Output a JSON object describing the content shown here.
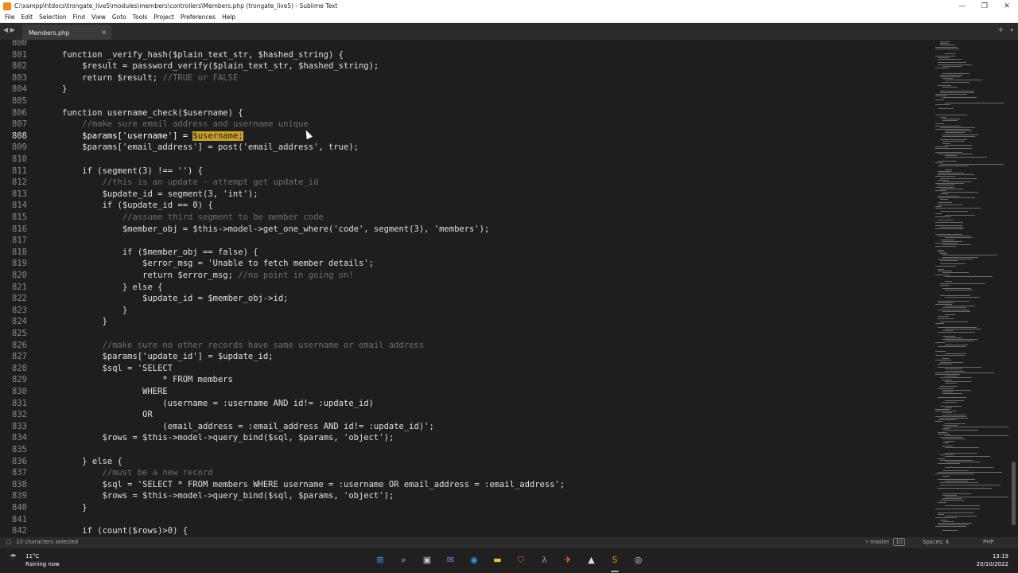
{
  "window": {
    "title": "C:\\xampp\\htdocs\\trongate_live5\\modules\\members\\controllers\\Members.php (trongate_live5) - Sublime Text",
    "min_glyph": "—",
    "max_glyph": "❐",
    "close_glyph": "✕"
  },
  "menu": [
    "File",
    "Edit",
    "Selection",
    "Find",
    "View",
    "Goto",
    "Tools",
    "Project",
    "Preferences",
    "Help"
  ],
  "tabs": {
    "nav_glyph": "◀ ▶",
    "active_tab": "Members.php",
    "close_glyph": "×",
    "add_glyph": "+",
    "menu_glyph": "▾"
  },
  "editor": {
    "line_numbers": [
      "800",
      "801",
      "802",
      "803",
      "804",
      "805",
      "806",
      "807",
      "808",
      "809",
      "810",
      "811",
      "812",
      "813",
      "814",
      "815",
      "816",
      "817",
      "818",
      "819",
      "820",
      "821",
      "822",
      "823",
      "824",
      "825",
      "826",
      "827",
      "828",
      "829",
      "830",
      "831",
      "832",
      "833",
      "834",
      "835",
      "836",
      "837",
      "838",
      "839",
      "840",
      "841",
      "842"
    ],
    "current_line": "808",
    "lines": [
      [
        {
          "t": ""
        }
      ],
      [
        {
          "t": "function _verify_hash($plain_text_str, $hashed_string) {"
        }
      ],
      [
        {
          "t": "    $result = password_verify($plain_text_str, $hashed_string);"
        }
      ],
      [
        {
          "t": "    return $result; "
        },
        {
          "t": "//TRUE or FALSE",
          "c": "comment"
        }
      ],
      [
        {
          "t": "}"
        }
      ],
      [
        {
          "t": ""
        }
      ],
      [
        {
          "t": "function username_check($username) {"
        }
      ],
      [
        {
          "t": "    "
        },
        {
          "t": "//make sure email address and username unique",
          "c": "comment"
        }
      ],
      [
        {
          "t": "    $params['username'] = "
        },
        {
          "t": "$username;",
          "c": "hl"
        }
      ],
      [
        {
          "t": "    $params['email_address'] = post('email_address', true);"
        }
      ],
      [
        {
          "t": ""
        }
      ],
      [
        {
          "t": "    if (segment(3) !== '') {"
        }
      ],
      [
        {
          "t": "        "
        },
        {
          "t": "//this is an update - attempt get update_id",
          "c": "comment"
        }
      ],
      [
        {
          "t": "        $update_id = segment(3, 'int');"
        }
      ],
      [
        {
          "t": "        if ($update_id == 0) {"
        }
      ],
      [
        {
          "t": "            "
        },
        {
          "t": "//assume third segment to be member code",
          "c": "comment"
        }
      ],
      [
        {
          "t": "            $member_obj = $this->model->get_one_where('code', segment(3), 'members');"
        }
      ],
      [
        {
          "t": ""
        }
      ],
      [
        {
          "t": "            if ($member_obj == false) {"
        }
      ],
      [
        {
          "t": "                $error_msg = 'Unable to fetch member details';"
        }
      ],
      [
        {
          "t": "                return $error_msg; "
        },
        {
          "t": "//no point in going on!",
          "c": "comment"
        }
      ],
      [
        {
          "t": "            } else {"
        }
      ],
      [
        {
          "t": "                $update_id = $member_obj->id;"
        }
      ],
      [
        {
          "t": "            }"
        }
      ],
      [
        {
          "t": "        }"
        }
      ],
      [
        {
          "t": ""
        }
      ],
      [
        {
          "t": "        "
        },
        {
          "t": "//make sure no other records have same username or email address",
          "c": "comment"
        }
      ],
      [
        {
          "t": "        $params['update_id'] = $update_id;"
        }
      ],
      [
        {
          "t": "        $sql = 'SELECT"
        }
      ],
      [
        {
          "t": "                    * FROM members"
        }
      ],
      [
        {
          "t": "                WHERE"
        }
      ],
      [
        {
          "t": "                    (username = :username AND id!= :update_id)"
        }
      ],
      [
        {
          "t": "                OR"
        }
      ],
      [
        {
          "t": "                    (email_address = :email_address AND id!= :update_id)';"
        }
      ],
      [
        {
          "t": "        $rows = $this->model->query_bind($sql, $params, 'object');"
        }
      ],
      [
        {
          "t": ""
        }
      ],
      [
        {
          "t": "    } else {"
        }
      ],
      [
        {
          "t": "        "
        },
        {
          "t": "//must be a new record",
          "c": "comment"
        }
      ],
      [
        {
          "t": "        $sql = 'SELECT * FROM members WHERE username = :username OR email_address = :email_address';"
        }
      ],
      [
        {
          "t": "        $rows = $this->model->query_bind($sql, $params, 'object');"
        }
      ],
      [
        {
          "t": "    }"
        }
      ],
      [
        {
          "t": ""
        }
      ],
      [
        {
          "t": "    if (count($rows)>0) {"
        }
      ]
    ]
  },
  "status_bar": {
    "selection": "10 characters selected",
    "git": "master",
    "git_badge": "10",
    "spaces": "Spaces: 4",
    "syntax": "PHP"
  },
  "taskbar": {
    "weather_temp": "11°C",
    "weather_desc": "Raining now",
    "weather_glyph": "☂",
    "icons": [
      {
        "name": "windows-start-icon",
        "glyph": "⊞",
        "color": "#3a9cf0"
      },
      {
        "name": "search-icon",
        "glyph": "⌕",
        "color": "#dddddd"
      },
      {
        "name": "task-view-icon",
        "glyph": "▣",
        "color": "#cccccc"
      },
      {
        "name": "teams-chat-icon",
        "glyph": "✉",
        "color": "#7b83eb"
      },
      {
        "name": "edge-browser-icon",
        "glyph": "◉",
        "color": "#1fa1e6"
      },
      {
        "name": "file-explorer-icon",
        "glyph": "▬",
        "color": "#f2c037"
      },
      {
        "name": "brave-browser-icon",
        "glyph": "⛉",
        "color": "#fb542b"
      },
      {
        "name": "xampp-icon",
        "glyph": "λ",
        "color": "#89b44f"
      },
      {
        "name": "postman-icon",
        "glyph": "✈",
        "color": "#ff6c37"
      },
      {
        "name": "inkscape-icon",
        "glyph": "▲",
        "color": "#dddddd"
      },
      {
        "name": "sublime-text-icon",
        "glyph": "S",
        "color": "#f28a0f"
      },
      {
        "name": "obs-icon",
        "glyph": "◎",
        "color": "#dddddd"
      }
    ],
    "time": "13:19",
    "date": "20/10/2022"
  },
  "colors": {
    "editor_bg": "#1e1e1e",
    "comment": "#6f6f6f",
    "highlight": "#c9a227",
    "text": "#e0e0e0"
  }
}
